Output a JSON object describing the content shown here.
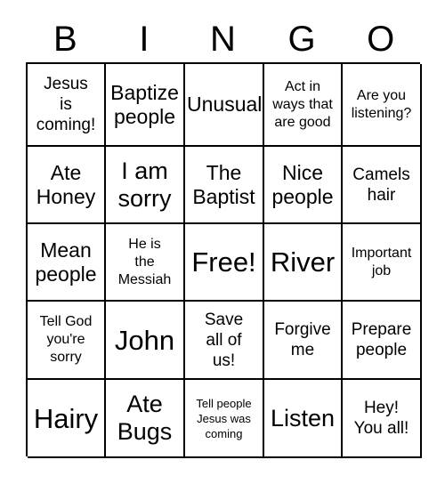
{
  "card": {
    "title": "BINGO",
    "header_letters": [
      "B",
      "I",
      "N",
      "G",
      "O"
    ],
    "columns": 5,
    "rows": 5,
    "border_color": "#000000",
    "background_color": "#ffffff",
    "text_color": "#000000",
    "free_space": "Free!",
    "free_space_position": {
      "row": 3,
      "column": 3
    }
  },
  "cells": [
    {
      "id": "r1c1",
      "text": "Jesus\nis\ncoming!",
      "size": "md",
      "row": 1,
      "column": 1
    },
    {
      "id": "r1c2",
      "text": "Baptize\npeople",
      "size": "lg",
      "row": 1,
      "column": 2
    },
    {
      "id": "r1c3",
      "text": "Unusual",
      "size": "lg",
      "row": 1,
      "column": 3
    },
    {
      "id": "r1c4",
      "text": "Act in\nways that\nare good",
      "size": "sm",
      "row": 1,
      "column": 4
    },
    {
      "id": "r1c5",
      "text": "Are you\nlistening?",
      "size": "sm",
      "row": 1,
      "column": 5
    },
    {
      "id": "r2c1",
      "text": "Ate\nHoney",
      "size": "lg",
      "row": 2,
      "column": 1
    },
    {
      "id": "r2c2",
      "text": "I am\nsorry",
      "size": "xl",
      "row": 2,
      "column": 2
    },
    {
      "id": "r2c3",
      "text": "The\nBaptist",
      "size": "lg",
      "row": 2,
      "column": 3
    },
    {
      "id": "r2c4",
      "text": "Nice\npeople",
      "size": "lg",
      "row": 2,
      "column": 4
    },
    {
      "id": "r2c5",
      "text": "Camels\nhair",
      "size": "md",
      "row": 2,
      "column": 5
    },
    {
      "id": "r3c1",
      "text": "Mean\npeople",
      "size": "lg",
      "row": 3,
      "column": 1
    },
    {
      "id": "r3c2",
      "text": "He is\nthe\nMessiah",
      "size": "sm",
      "row": 3,
      "column": 2
    },
    {
      "id": "r3c3",
      "text": "Free!",
      "size": "xxl",
      "row": 3,
      "column": 3
    },
    {
      "id": "r3c4",
      "text": "River",
      "size": "xxl",
      "row": 3,
      "column": 4
    },
    {
      "id": "r3c5",
      "text": "Important\njob",
      "size": "sm",
      "row": 3,
      "column": 5
    },
    {
      "id": "r4c1",
      "text": "Tell God\nyou're\nsorry",
      "size": "sm",
      "row": 4,
      "column": 1
    },
    {
      "id": "r4c2",
      "text": "John",
      "size": "xxl",
      "row": 4,
      "column": 2
    },
    {
      "id": "r4c3",
      "text": "Save\nall of\nus!",
      "size": "md",
      "row": 4,
      "column": 3
    },
    {
      "id": "r4c4",
      "text": "Forgive\nme",
      "size": "md",
      "row": 4,
      "column": 4
    },
    {
      "id": "r4c5",
      "text": "Prepare\npeople",
      "size": "md",
      "row": 4,
      "column": 5
    },
    {
      "id": "r5c1",
      "text": "Hairy",
      "size": "xxl",
      "row": 5,
      "column": 1
    },
    {
      "id": "r5c2",
      "text": "Ate\nBugs",
      "size": "xl",
      "row": 5,
      "column": 2
    },
    {
      "id": "r5c3",
      "text": "Tell people\nJesus was\ncoming",
      "size": "xs",
      "row": 5,
      "column": 3
    },
    {
      "id": "r5c4",
      "text": "Listen",
      "size": "xl",
      "row": 5,
      "column": 4
    },
    {
      "id": "r5c5",
      "text": "Hey!\nYou all!",
      "size": "md",
      "row": 5,
      "column": 5
    }
  ]
}
